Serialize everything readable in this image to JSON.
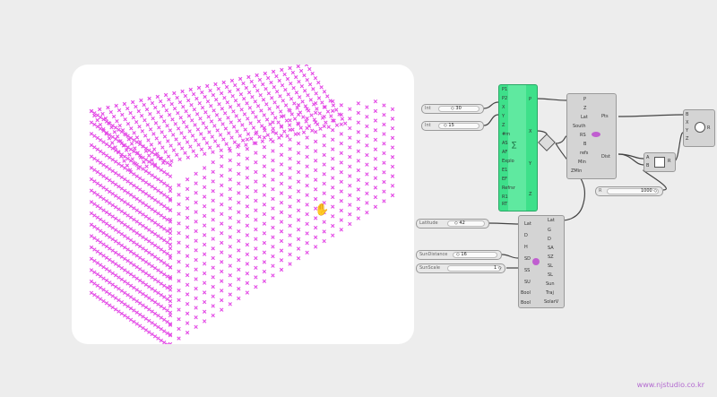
{
  "colors": {
    "points": "#e44ce6",
    "node_green": "#3ee08a",
    "node_gray": "#d4d4d4",
    "wire": "#444444"
  },
  "sliders": [
    {
      "name": "Int",
      "value": "◇ 30"
    },
    {
      "name": "Int",
      "value": "◇ 15"
    },
    {
      "name": "Latitude",
      "value": "◇ 42"
    },
    {
      "name": "SunDistance",
      "value": "◇ 16"
    },
    {
      "name": "SunScale",
      "value": "1 ◇"
    },
    {
      "name": "R",
      "value": "1000 ◇"
    }
  ],
  "green_node": {
    "inputs": [
      "P1",
      "P2",
      "X",
      "Y",
      "Z",
      "#m",
      "AS",
      "AF",
      "Explo",
      "E1",
      "EF",
      "Refrsr",
      "R1",
      "RT"
    ],
    "outputs": [
      "P",
      "X",
      "Y",
      "Z"
    ]
  },
  "sun_node": {
    "inputs": [
      "P",
      "Z",
      "Lat",
      "South",
      "RS",
      "B",
      "refs",
      "Min",
      "ZMin"
    ],
    "outputs": [
      "Pts",
      "Dist"
    ]
  },
  "solar_node": {
    "inputs": [
      "Lat",
      "D",
      "H",
      "SD",
      "SS",
      "SU",
      "Bool",
      "Bool"
    ],
    "outputs": [
      "Lat",
      "G",
      "D",
      "SA",
      "SZ",
      "SL",
      "SL",
      "Sun",
      "Traj",
      "SolarV"
    ]
  },
  "small_node": {
    "inputs": [
      "A",
      "B"
    ],
    "outputs": [
      "R"
    ]
  },
  "merge_node": {
    "inputs": [
      "B",
      "X",
      "Y",
      "Z"
    ],
    "outputs": [
      "R"
    ]
  },
  "watermark": "www.njstudio.co.kr",
  "icons": [
    "cursor-hand-icon",
    "expression-icon",
    "solar-icon",
    "gradient-icon",
    "sphere-icon",
    "relay-icon"
  ]
}
